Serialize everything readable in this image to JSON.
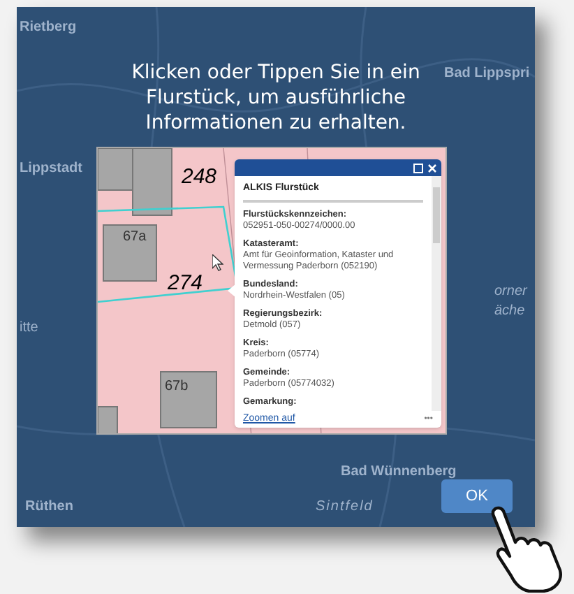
{
  "map_labels": [
    "Rietberg",
    "Bad Lippspri",
    "Lippstadt",
    "itte",
    "orner",
    "äche",
    "Bad Wünnenberg",
    "Rüthen",
    "Sintfeld"
  ],
  "message": "Klicken oder Tippen Sie in ein Flurstück, um ausführliche Informationen zu erhalten.",
  "parcel_labels": [
    "248",
    "67a",
    "274",
    "67b"
  ],
  "popup": {
    "title": "ALKIS Flurstück",
    "fields": [
      {
        "label": "Flurstückskennzeichen:",
        "value": "052951-050-00274/0000.00"
      },
      {
        "label": "Katasteramt:",
        "value": "Amt für Geoinformation, Kataster und Vermessung Paderborn (052190)"
      },
      {
        "label": "Bundesland:",
        "value": "Nordrhein-Westfalen (05)"
      },
      {
        "label": "Regierungsbezirk:",
        "value": "Detmold (057)"
      },
      {
        "label": "Kreis:",
        "value": "Paderborn (05774)"
      },
      {
        "label": "Gemeinde:",
        "value": "Paderborn (05774032)"
      },
      {
        "label": "Gemarkung:"
      }
    ],
    "link": "Zoomen auf",
    "more": "•••"
  },
  "ok_button": "OK"
}
